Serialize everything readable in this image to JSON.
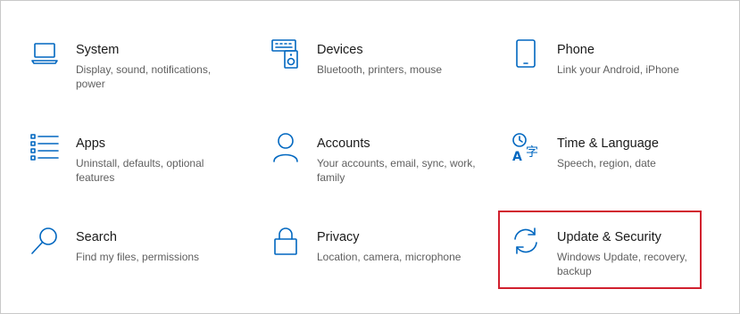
{
  "tiles": [
    {
      "title": "System",
      "desc": "Display, sound, notifications, power",
      "icon": "laptop-icon"
    },
    {
      "title": "Devices",
      "desc": "Bluetooth, printers, mouse",
      "icon": "keyboard-speaker-icon"
    },
    {
      "title": "Phone",
      "desc": "Link your Android, iPhone",
      "icon": "phone-icon"
    },
    {
      "title": "Apps",
      "desc": "Uninstall, defaults, optional features",
      "icon": "apps-list-icon"
    },
    {
      "title": "Accounts",
      "desc": "Your accounts, email, sync, work, family",
      "icon": "person-icon"
    },
    {
      "title": "Time & Language",
      "desc": "Speech, region, date",
      "icon": "time-language-icon"
    },
    {
      "title": "Search",
      "desc": "Find my files, permissions",
      "icon": "search-icon"
    },
    {
      "title": "Privacy",
      "desc": "Location, camera, microphone",
      "icon": "lock-icon"
    },
    {
      "title": "Update & Security",
      "desc": "Windows Update, recovery, backup",
      "icon": "sync-icon"
    }
  ],
  "highlighted_tile": "Update & Security",
  "colors": {
    "accent": "#0067c0",
    "highlight": "#d1202e",
    "title": "#1a1a1a",
    "desc": "#5f5f5f"
  }
}
